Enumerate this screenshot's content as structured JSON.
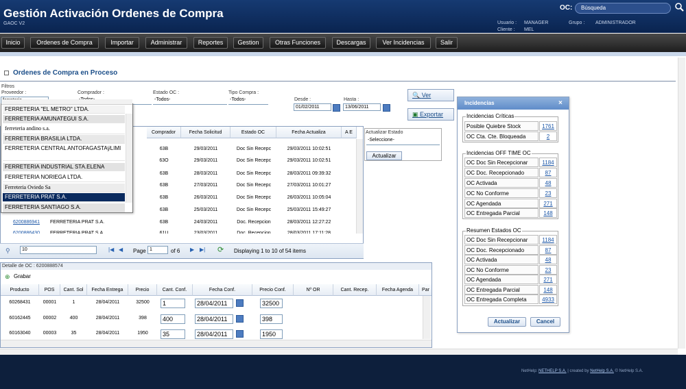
{
  "header": {
    "title": "Gestión Activación Ordenes de Compra",
    "subtitle": "GAOC V2",
    "oc_label": "OC:",
    "search_placeholder": "Búsqueda",
    "usuario_label": "Usuario :",
    "usuario_value": "MANAGER",
    "grupo_label": "Grupo :",
    "grupo_value": "ADMINISTRADOR",
    "cliente_label": "Cliente :",
    "cliente_value": "MEL"
  },
  "nav": [
    "Inicio",
    "Ordenes de Compra",
    "Importar",
    "Administrar",
    "Reportes",
    "Gestion",
    "Otras Funciones",
    "Descargas",
    "Ver Incidencias",
    "Salir"
  ],
  "page_title": "Ordenes de Compra en Proceso",
  "filters": {
    "section": "Filtros",
    "proveedor_label": "Proveedor :",
    "proveedor_value": "ferreteria",
    "comprador_label": "Comprador :",
    "comprador_value": "-Todos-",
    "estado_label": "Estado OC :",
    "estado_value": "-Todos-",
    "tipo_label": "Tipo Compra :",
    "tipo_value": "-Todos-",
    "desde_label": "Desde :",
    "desde_value": "01/02/2011",
    "hasta_label": "Hasta :",
    "hasta_value": "13/06/2011",
    "ver": "Ver",
    "exportar": "Exportar"
  },
  "autocomplete": [
    "FERRETERIA \"EL METRO\" LTDA.",
    "FERRETERIA AMUNATEGUI S.A.",
    "ferreteria andino s.a.",
    "FERRETERIA BRASILIA LTDA.",
    "FERRETERIA CENTRAL ANTOFAGASTAÿLIMI",
    "FERRETERIA INDUSTRIAL STA.ELENA",
    "FERRETERIA NORIEGA LTDA.",
    "Ferreteria Oviedo Sa",
    "FERRETERIA PRAT S.A.",
    "FERRETERIA SANTIAGO S.A."
  ],
  "grid": {
    "columns": [
      "Comprador",
      "Fecha Solicitud",
      "Estado OC",
      "Fecha Actualiza",
      "A E"
    ],
    "rows": [
      {
        "comprador": "63B",
        "fecha": "29/03/2011",
        "estado": "Doc Sin Recepc",
        "actualiza": "29/03/2011 10:02:51"
      },
      {
        "comprador": "63O",
        "fecha": "29/03/2011",
        "estado": "Doc Sin Recepc",
        "actualiza": "29/03/2011 10:02:51"
      },
      {
        "comprador": "63B",
        "fecha": "28/03/2011",
        "estado": "Doc Sin Recepc",
        "actualiza": "28/03/2011 09:39:32"
      },
      {
        "comprador": "63B",
        "fecha": "27/03/2011",
        "estado": "Doc Sin Recepc",
        "actualiza": "27/03/2011 10:01:27"
      },
      {
        "comprador": "63B",
        "fecha": "26/03/2011",
        "estado": "Doc Sin Recepc",
        "actualiza": "26/03/2011 10:05:04"
      },
      {
        "comprador": "63B",
        "fecha": "25/03/2011",
        "estado": "Doc Sin Recepc",
        "actualiza": "25/03/2011 15:49:27"
      },
      {
        "oc": "6200886941",
        "proveedor": "FERRETERIA PRAT S.A.",
        "comprador": "63B",
        "fecha": "24/03/2011",
        "estado": "Doc. Recepcion",
        "actualiza": "28/03/2011 12:27:22"
      },
      {
        "oc": "6200886430",
        "proveedor": "FERRETERIA PRAT S.A.",
        "comprador": "61U",
        "fecha": "23/03/2011",
        "estado": "Doc. Recepcion",
        "actualiza": "28/03/2011 17:11:28"
      }
    ]
  },
  "actualizar": {
    "label": "Actualizar Estado",
    "select": "-Seleccione-",
    "button": "Actualizar"
  },
  "pager": {
    "size": "10",
    "page_label": "Page",
    "page": "1",
    "of": "of 6",
    "info": "Displaying 1 to 10 of 54 items"
  },
  "detail": {
    "title": "Detalle de OC : 6200888574",
    "grabar": "Grabar",
    "columns": [
      "Producto",
      "POS",
      "Cant. Sol",
      "Fecha Entrega",
      "Precio",
      "Cant. Conf.",
      "Fecha Conf.",
      "Precio Conf.",
      "Nº OR",
      "Cant. Recep.",
      "Fecha Agenda",
      "Par"
    ],
    "rows": [
      {
        "producto": "60268431",
        "pos": "00001",
        "cant": "1",
        "fecha": "28/04/2011",
        "precio": "32500",
        "cconf": "1",
        "fconf": "28/04/2011",
        "pconf": "32500"
      },
      {
        "producto": "60162445",
        "pos": "00002",
        "cant": "400",
        "fecha": "28/04/2011",
        "precio": "398",
        "cconf": "400",
        "fconf": "28/04/2011",
        "pconf": "398"
      },
      {
        "producto": "60163040",
        "pos": "00003",
        "cant": "35",
        "fecha": "28/04/2011",
        "precio": "1950",
        "cconf": "35",
        "fconf": "28/04/2011",
        "pconf": "1950"
      }
    ]
  },
  "incidencias": {
    "title": "Incidencias",
    "criticas_legend": "Incidencias Críticas",
    "criticas": [
      {
        "label": "Posible Quiebre Stock",
        "value": "1761"
      },
      {
        "label": "OC Cta. Cte. Bloqueada",
        "value": "2"
      }
    ],
    "offtime_legend": "Incidencias OFF TIME OC",
    "offtime": [
      {
        "label": "OC Doc Sin Recepcionar",
        "value": "1184"
      },
      {
        "label": "OC Doc. Recepcionado",
        "value": "87"
      },
      {
        "label": "OC Activada",
        "value": "48"
      },
      {
        "label": "OC No Conforme",
        "value": "23"
      },
      {
        "label": "OC Agendada",
        "value": "271"
      },
      {
        "label": "OC Entregada Parcial",
        "value": "148"
      }
    ],
    "resumen_legend": "Resumen Estados OC",
    "resumen": [
      {
        "label": "OC Doc Sin Recepcionar",
        "value": "1184"
      },
      {
        "label": "OC Doc. Recepcionado",
        "value": "87"
      },
      {
        "label": "OC Activada",
        "value": "48"
      },
      {
        "label": "OC No Conforme",
        "value": "23"
      },
      {
        "label": "OC Agendada",
        "value": "271"
      },
      {
        "label": "OC Entregada Parcial",
        "value": "148"
      },
      {
        "label": "OC Entregada Completa",
        "value": "4933"
      }
    ],
    "actualizar": "Actualizar",
    "cancel": "Cancel"
  },
  "footer": {
    "prefix": "NetHelp:",
    "link1": "NETHELP S.A.",
    "mid": "| created by",
    "link2": "NetHelp S.A.",
    "copy": "© NetHelp S.A."
  }
}
